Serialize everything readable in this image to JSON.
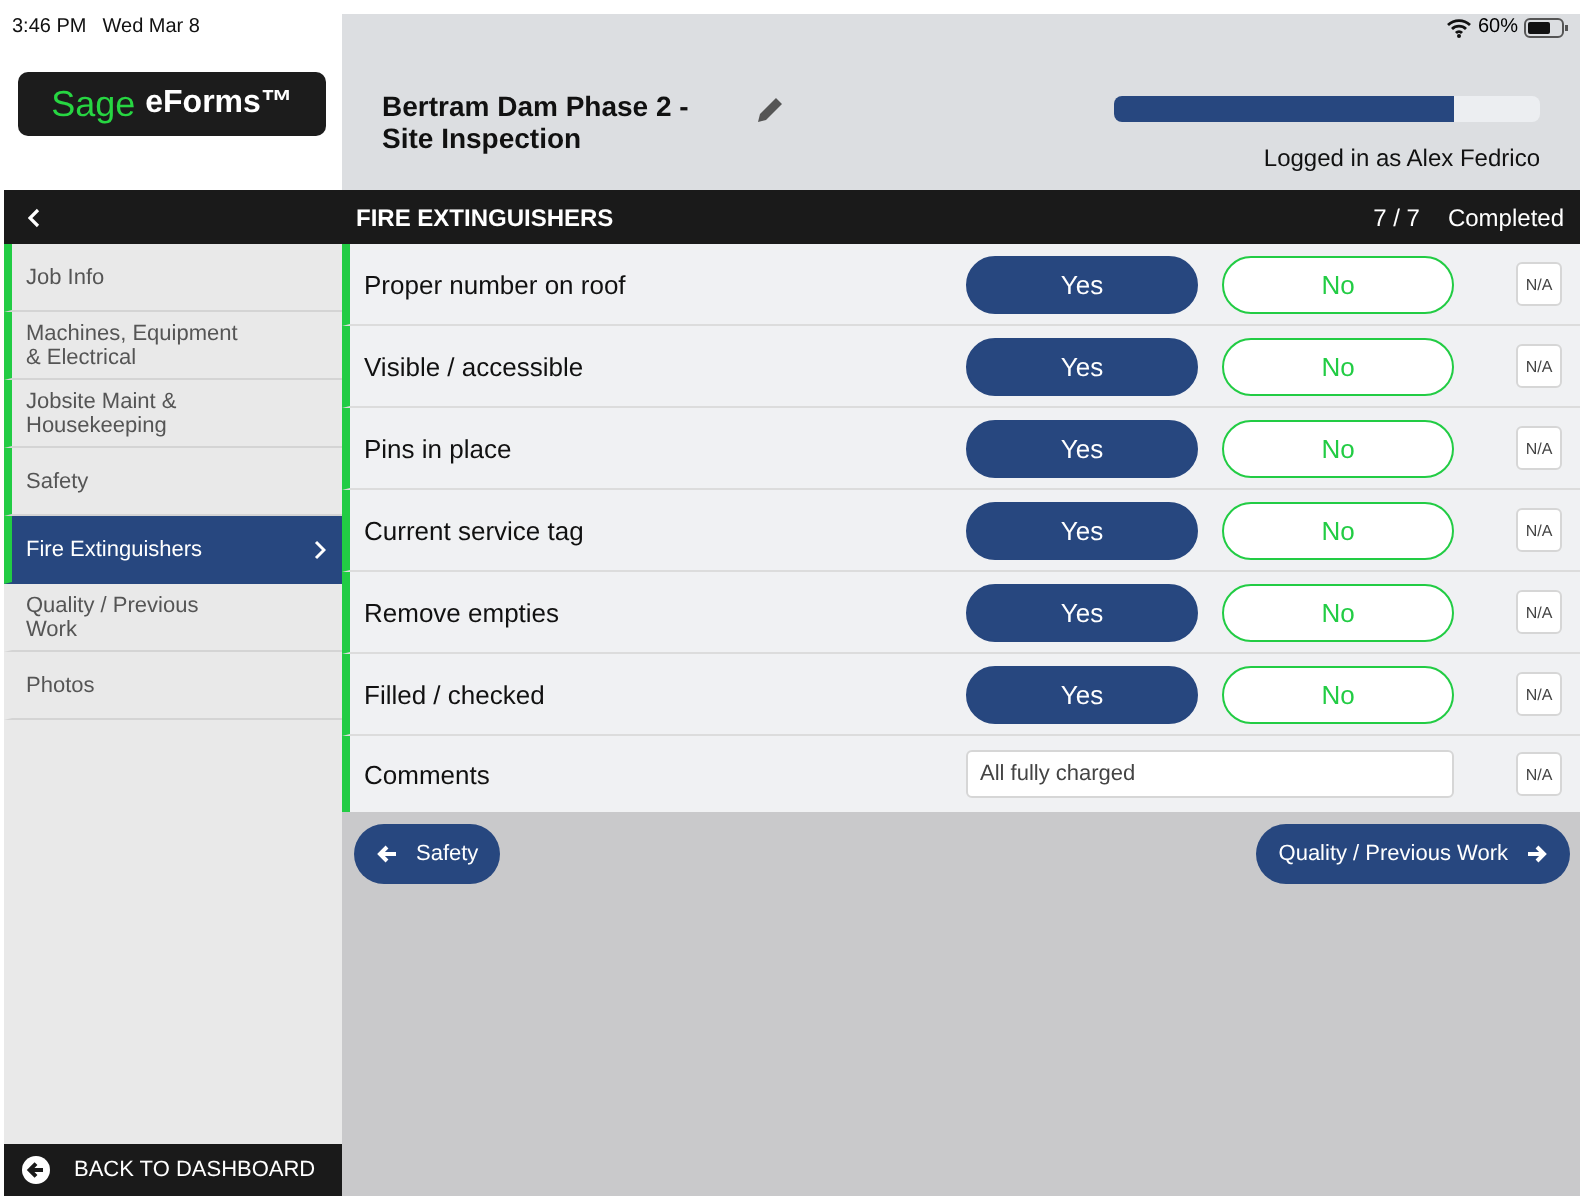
{
  "status_bar": {
    "time": "3:46 PM",
    "date": "Wed Mar 8",
    "battery": "60%"
  },
  "logo": {
    "brand": "Sage",
    "product": "eForms™"
  },
  "header": {
    "title": "Bertram Dam Phase 2 - Site Inspection",
    "progress": {
      "level": 0.8
    },
    "user": "Logged in as Alex Fedrico"
  },
  "section": {
    "title": "FIRE EXTINGUISHERS",
    "count": "7 / 7",
    "status": "Completed"
  },
  "sidebar": {
    "items": [
      {
        "label": "Job Info",
        "completed": true,
        "selected": false
      },
      {
        "label": "Machines, Equipment & Electrical",
        "completed": true,
        "selected": false
      },
      {
        "label": "Jobsite Maint & Housekeeping",
        "completed": true,
        "selected": false
      },
      {
        "label": "Safety",
        "completed": true,
        "selected": false
      },
      {
        "label": "Fire Extinguishers",
        "completed": true,
        "selected": true
      },
      {
        "label": "Quality / Previous Work",
        "completed": false,
        "selected": false
      },
      {
        "label": "Photos",
        "completed": false,
        "selected": false
      }
    ],
    "back": "BACK TO DASHBOARD"
  },
  "form": {
    "rows": [
      {
        "kind": "yesno",
        "label": "Proper number on roof",
        "answered": true,
        "options": [
          {
            "label": "Yes",
            "selected": true
          },
          {
            "label": "No",
            "selected": false
          }
        ],
        "na": "N/A"
      },
      {
        "kind": "yesno",
        "label": "Visible / accessible",
        "answered": true,
        "options": [
          {
            "label": "Yes",
            "selected": true
          },
          {
            "label": "No",
            "selected": false
          }
        ],
        "na": "N/A"
      },
      {
        "kind": "yesno",
        "label": "Pins in place",
        "answered": true,
        "options": [
          {
            "label": "Yes",
            "selected": true
          },
          {
            "label": "No",
            "selected": false
          }
        ],
        "na": "N/A"
      },
      {
        "kind": "yesno",
        "label": "Current service tag",
        "answered": true,
        "options": [
          {
            "label": "Yes",
            "selected": true
          },
          {
            "label": "No",
            "selected": false
          }
        ],
        "na": "N/A"
      },
      {
        "kind": "yesno",
        "label": "Remove empties",
        "answered": true,
        "options": [
          {
            "label": "Yes",
            "selected": true
          },
          {
            "label": "No",
            "selected": false
          }
        ],
        "na": "N/A"
      },
      {
        "kind": "yesno",
        "label": "Filled / checked",
        "answered": true,
        "options": [
          {
            "label": "Yes",
            "selected": true
          },
          {
            "label": "No",
            "selected": false
          }
        ],
        "na": "N/A"
      },
      {
        "kind": "text",
        "label": "Comments",
        "answered": true,
        "value": "All fully charged",
        "na": "N/A"
      }
    ],
    "previous": "Safety",
    "next": "Quality / Previous Work"
  }
}
